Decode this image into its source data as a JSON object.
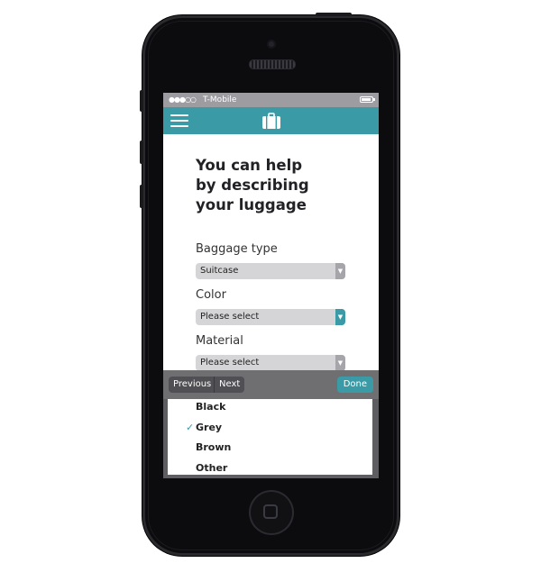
{
  "status_bar": {
    "signal": "●●●○○",
    "carrier": "T-Mobile"
  },
  "header": {
    "menu_icon": "hamburger-menu-icon",
    "logo_icon": "suitcase-icon"
  },
  "main": {
    "title": "You can help\nby describing\nyour luggage",
    "fields": [
      {
        "label": "Baggage type",
        "value": "Suitcase"
      },
      {
        "label": "Color",
        "value": "Please select"
      },
      {
        "label": "Material",
        "value": "Please select"
      }
    ]
  },
  "keyboard_toolbar": {
    "previous": "Previous",
    "next": "Next",
    "done": "Done"
  },
  "picker": {
    "options": [
      {
        "label": "Black",
        "selected": false
      },
      {
        "label": "Grey",
        "selected": true
      },
      {
        "label": "Brown",
        "selected": false
      },
      {
        "label": "Other",
        "selected": false
      }
    ],
    "check_mark": "✓"
  },
  "colors": {
    "accent": "#3a9aa5",
    "status_bar": "#9d9da1",
    "field_bg": "#d5d5d7"
  }
}
